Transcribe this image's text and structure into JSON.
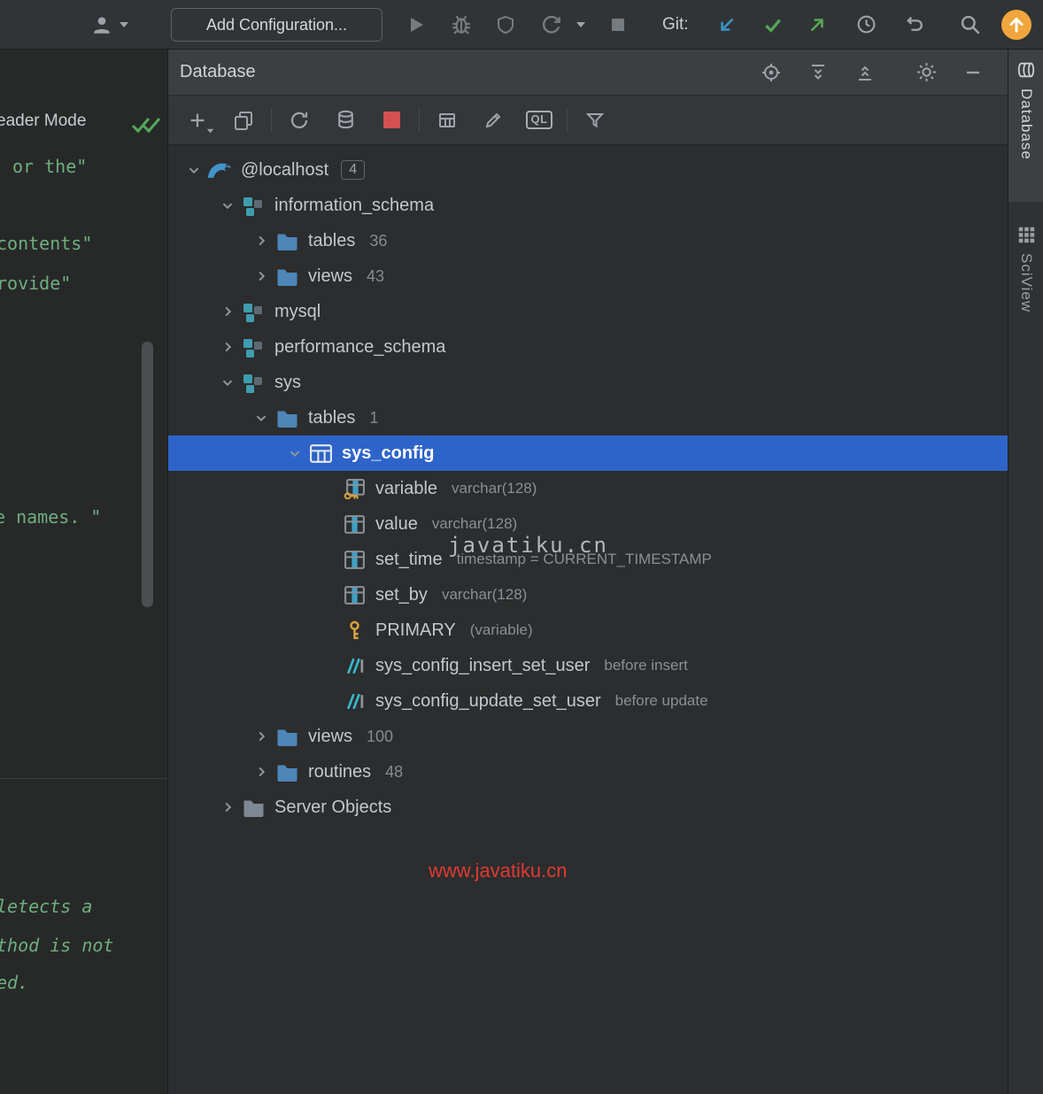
{
  "topbar": {
    "add_configuration": "Add Configuration...",
    "git_label": "Git:"
  },
  "db_panel": {
    "title": "Database",
    "ql_label": "QL"
  },
  "right_tabs": {
    "database": "Database",
    "sciview": "SciView"
  },
  "watermarks": {
    "overlay": "javatiku.cn",
    "footer": "www.javatiku.cn"
  },
  "editor_fragments": [
    {
      "text": "eader Mode",
      "style": "ui"
    },
    {
      "text": "or the\"",
      "style": "string"
    },
    {
      "text": "contents\"",
      "style": "string"
    },
    {
      "text": "rovide\"",
      "style": "string"
    },
    {
      "text": "e names. \"",
      "style": "string"
    },
    {
      "text": "letects a",
      "style": "comment"
    },
    {
      "text": "thod is not",
      "style": "comment"
    },
    {
      "text": "ed.",
      "style": "comment"
    }
  ],
  "tree": {
    "rows": [
      {
        "level": 0,
        "chevron": "down",
        "icon": "mysql",
        "label": "@localhost",
        "badge": "4"
      },
      {
        "level": 1,
        "chevron": "down",
        "icon": "schema",
        "label": "information_schema"
      },
      {
        "level": 2,
        "chevron": "right",
        "icon": "folder",
        "label": "tables",
        "count": "36"
      },
      {
        "level": 2,
        "chevron": "right",
        "icon": "folder",
        "label": "views",
        "count": "43"
      },
      {
        "level": 1,
        "chevron": "right",
        "icon": "schema",
        "label": "mysql"
      },
      {
        "level": 1,
        "chevron": "right",
        "icon": "schema",
        "label": "performance_schema"
      },
      {
        "level": 1,
        "chevron": "down",
        "icon": "schema",
        "label": "sys"
      },
      {
        "level": 2,
        "chevron": "down",
        "icon": "folder",
        "label": "tables",
        "count": "1"
      },
      {
        "level": 3,
        "chevron": "down",
        "icon": "table",
        "label": "sys_config",
        "selected": true
      },
      {
        "level": 4,
        "icon": "column-key",
        "label": "variable",
        "type": "varchar(128)"
      },
      {
        "level": 4,
        "icon": "column",
        "label": "value",
        "type": "varchar(128)"
      },
      {
        "level": 4,
        "icon": "column",
        "label": "set_time",
        "type": "timestamp = CURRENT_TIMESTAMP"
      },
      {
        "level": 4,
        "icon": "column",
        "label": "set_by",
        "type": "varchar(128)"
      },
      {
        "level": 4,
        "icon": "key",
        "label": "PRIMARY",
        "type": "(variable)"
      },
      {
        "level": 4,
        "icon": "trigger",
        "label": "sys_config_insert_set_user",
        "type": "before insert"
      },
      {
        "level": 4,
        "icon": "trigger",
        "label": "sys_config_update_set_user",
        "type": "before update"
      },
      {
        "level": 2,
        "chevron": "right",
        "icon": "folder",
        "label": "views",
        "count": "100"
      },
      {
        "level": 2,
        "chevron": "right",
        "icon": "folder",
        "label": "routines",
        "count": "48"
      },
      {
        "level": 1,
        "chevron": "right",
        "icon": "folder-server",
        "label": "Server Objects"
      }
    ]
  },
  "colors": {
    "selection": "#2E64C9",
    "accent_orange": "#F0A63C",
    "git_update_blue": "#3B93C5",
    "git_commit_green": "#57A757",
    "watermark_red": "#DF3A33"
  }
}
